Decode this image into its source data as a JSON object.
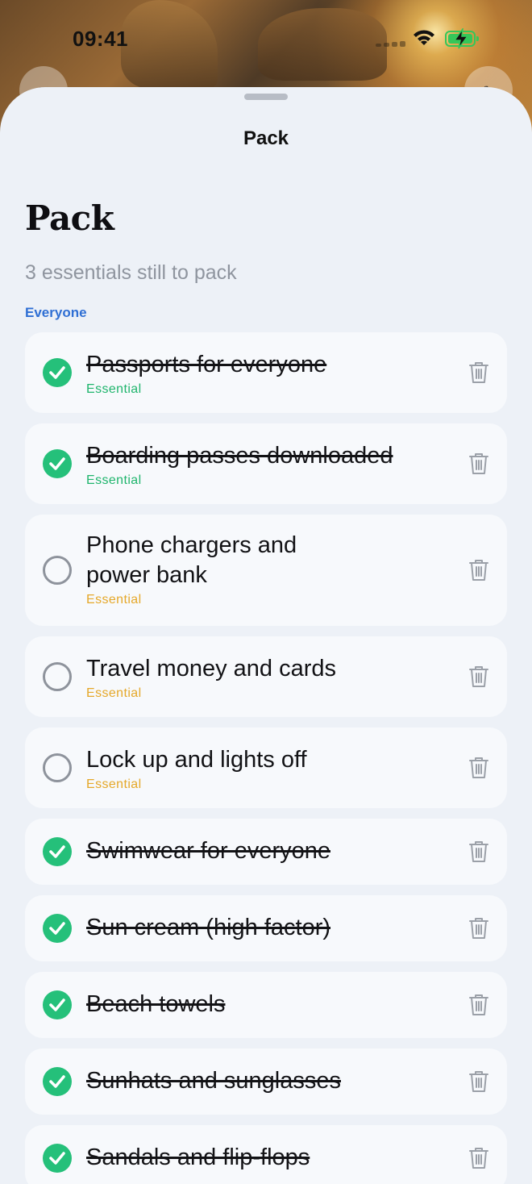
{
  "status": {
    "time": "09:41"
  },
  "sheet": {
    "nav_title": "Pack",
    "title": "Pack",
    "subtitle": "3 essentials still to pack",
    "section": "Everyone"
  },
  "colors": {
    "accent": "#2f6fd4",
    "done": "#25c07a",
    "essential_done": "#20b56d",
    "essential_todo": "#e5a82a"
  },
  "items": [
    {
      "title": "Passports for everyone",
      "tag": "Essential",
      "checked": true
    },
    {
      "title": "Boarding passes downloaded",
      "tag": "Essential",
      "checked": true
    },
    {
      "title": "Phone chargers and power bank",
      "tag": "Essential",
      "checked": false
    },
    {
      "title": "Travel money and cards",
      "tag": "Essential",
      "checked": false
    },
    {
      "title": "Lock up and lights off",
      "tag": "Essential",
      "checked": false
    },
    {
      "title": "Swimwear for everyone",
      "checked": true
    },
    {
      "title": "Sun cream (high factor)",
      "checked": true
    },
    {
      "title": "Beach towels",
      "checked": true
    },
    {
      "title": "Sunhats and sunglasses",
      "checked": true
    },
    {
      "title": "Sandals and flip-flops",
      "checked": true
    }
  ]
}
